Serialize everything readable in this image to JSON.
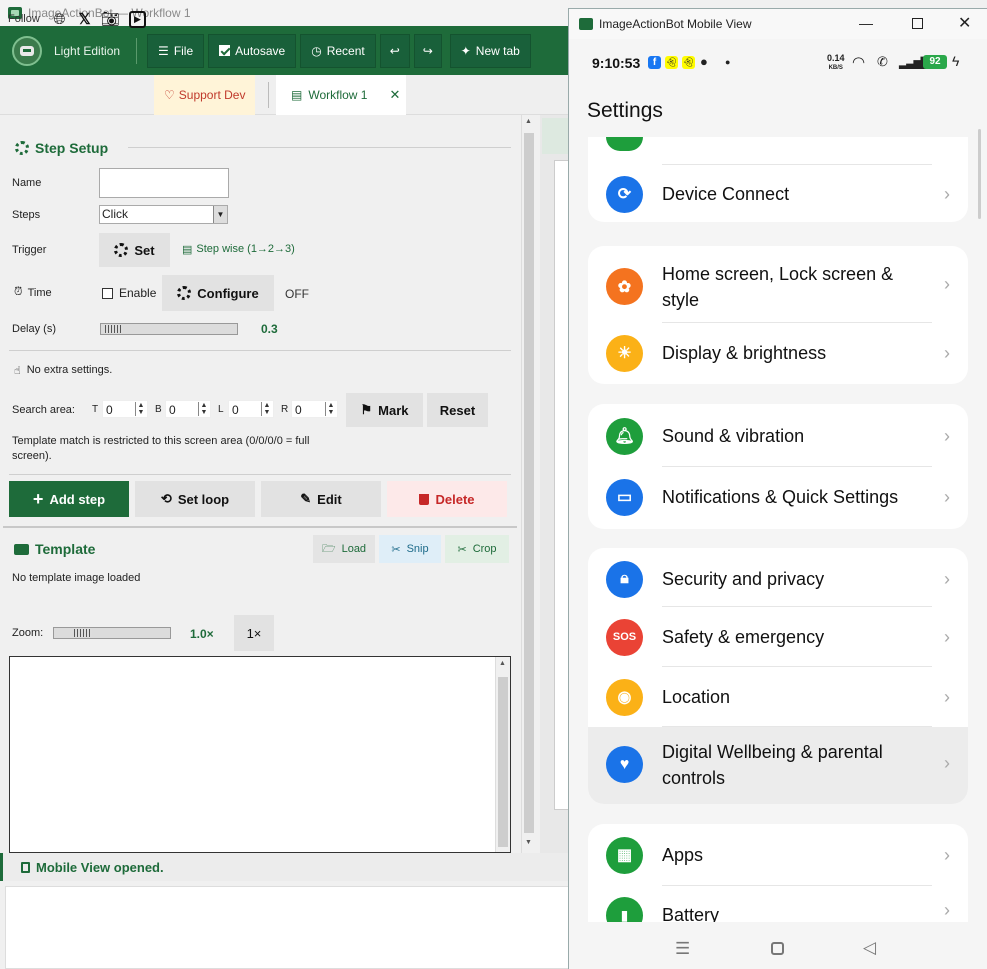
{
  "main": {
    "title": "ImageActionBot — Workflow 1",
    "toolbar": {
      "edition": "Light Edition",
      "file": "File",
      "autosave": "Autosave",
      "recent": "Recent",
      "undo": "↩",
      "redo": "↪",
      "new_tab": "New tab"
    },
    "follow": {
      "label": "Follow",
      "support": "Support Dev"
    },
    "tab": {
      "label": "Workflow 1",
      "close": "✕"
    },
    "step_setup": {
      "title": "Step Setup",
      "name_label": "Name",
      "name_value": "",
      "steps_label": "Steps",
      "steps_value": "Click",
      "trigger_label": "Trigger",
      "set_button": "Set",
      "trigger_info": "Step wise (1→2→3)",
      "time_label": "Time",
      "enable_label": "Enable",
      "configure_button": "Configure",
      "time_state": "OFF",
      "delay_label": "Delay (s)",
      "delay_value": "0.3",
      "delay_fraction": 0.03,
      "no_extra": "No extra settings.",
      "search_area_label": "Search area:",
      "t_label": "T",
      "t_value": "0",
      "b_label": "B",
      "b_value": "0",
      "l_label": "L",
      "l_value": "0",
      "r_label": "R",
      "r_value": "0",
      "mark_button": "Mark",
      "reset_button": "Reset",
      "note": "Template match is restricted to this screen area (0/0/0/0 = full screen).",
      "add_step": "Add step",
      "set_loop": "Set loop",
      "edit": "Edit",
      "delete": "Delete"
    },
    "template": {
      "title": "Template",
      "load": "Load",
      "snip": "Snip",
      "crop": "Crop",
      "empty": "No template image loaded",
      "zoom_label": "Zoom:",
      "zoom_value": "1.0×",
      "zoom_reset": "1×",
      "zoom_fraction": 0.2
    },
    "status": "Mobile View opened."
  },
  "mobile": {
    "title": "ImageActionBot Mobile View",
    "status_bar": {
      "time": "9:10:53",
      "speed_top": "0.14",
      "speed_unit": "KB/S",
      "battery": "92"
    },
    "header": "Settings",
    "items": [
      {
        "label": "Device Connect",
        "color": "#1a73e8"
      },
      {
        "label": "Home screen, Lock screen & style",
        "color": "#f4731f"
      },
      {
        "label": "Display & brightness",
        "color": "#fbb117"
      },
      {
        "label": "Sound & vibration",
        "color": "#1e9e3c"
      },
      {
        "label": "Notifications & Quick Settings",
        "color": "#1a73e8"
      },
      {
        "label": "Security and privacy",
        "color": "#1a73e8"
      },
      {
        "label": "Safety & emergency",
        "color": "#ea4335",
        "icon_text": "SOS"
      },
      {
        "label": "Location",
        "color": "#fbb117"
      },
      {
        "label": "Digital Wellbeing & parental controls",
        "color": "#1a73e8"
      },
      {
        "label": "Apps",
        "color": "#1e9e3c"
      },
      {
        "label": "Battery",
        "color": "#1e9e3c"
      }
    ]
  }
}
